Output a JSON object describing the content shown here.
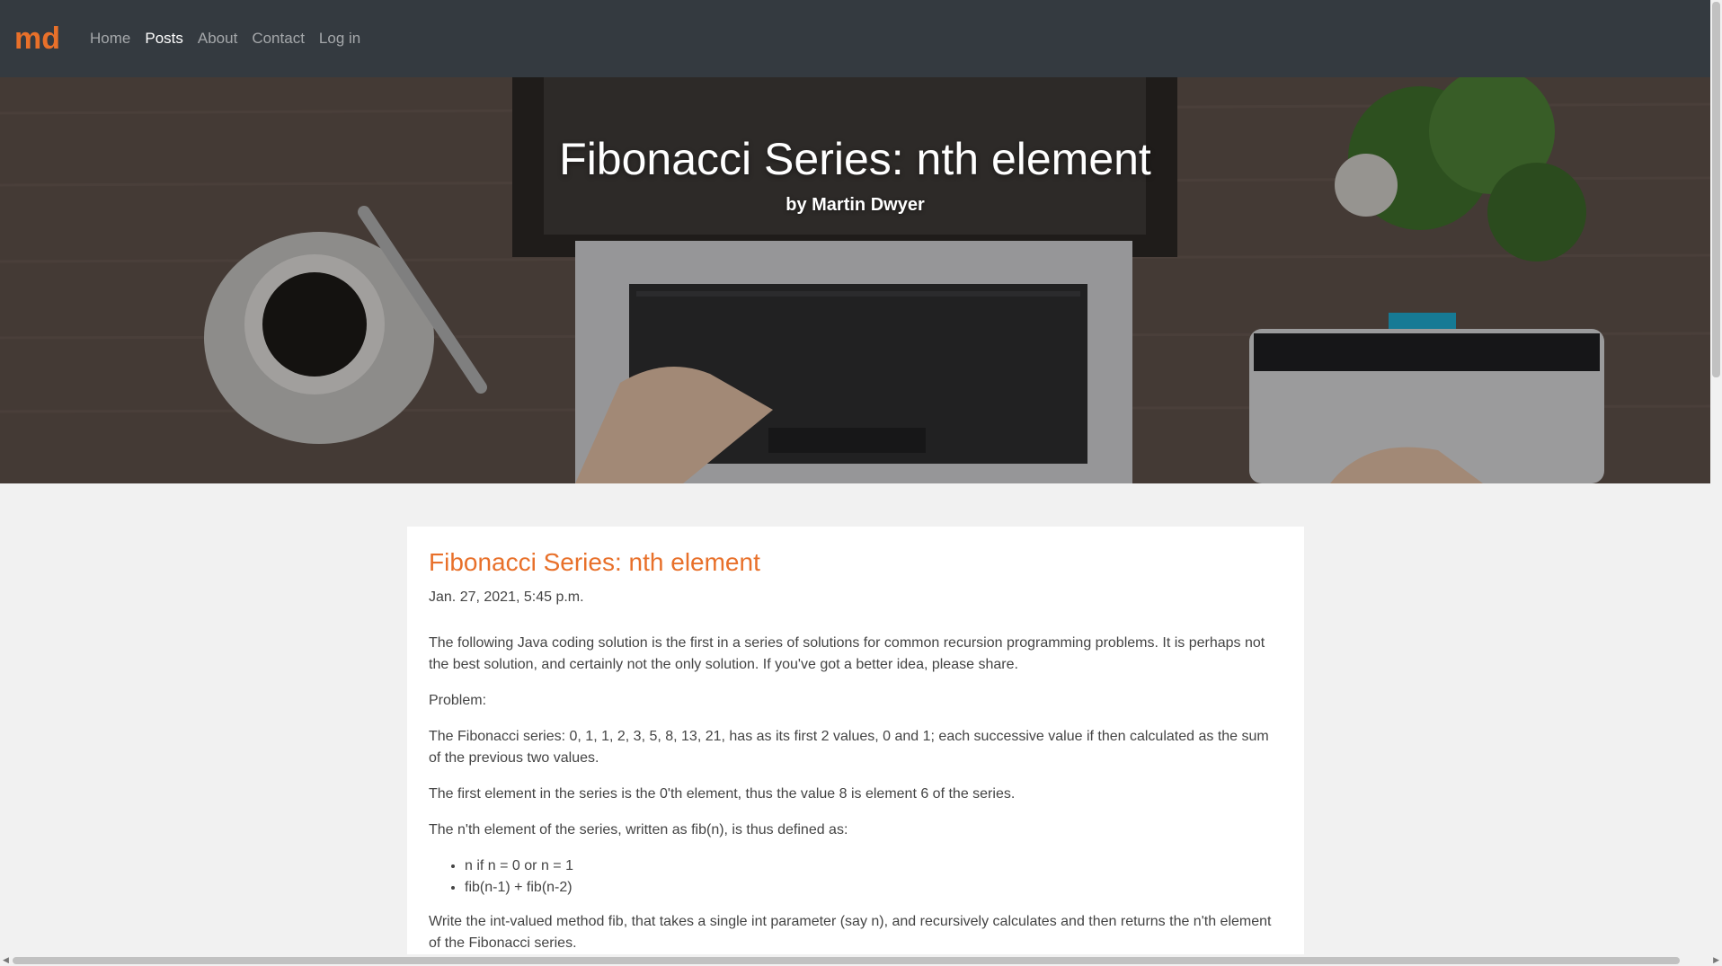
{
  "nav": {
    "brand": "md",
    "links": [
      "Home",
      "Posts",
      "About",
      "Contact",
      "Log in"
    ],
    "active": "Posts"
  },
  "hero": {
    "title": "Fibonacci Series: nth element",
    "author": "by Martin Dwyer"
  },
  "post": {
    "title": "Fibonacci Series: nth element",
    "date": "Jan. 27, 2021, 5:45 p.m.",
    "paragraphs": [
      "The following Java coding solution is the first in a series of solutions for common recursion programming problems. It is perhaps not the best solution, and certainly not the only solution. If you've got a better idea, please share.",
      "Problem:",
      "The Fibonacci series: 0, 1, 1, 2, 3, 5, 8, 13, 21, has as its first 2 values, 0 and 1; each successive value if then calculated as the sum of the previous two values.",
      "The first element in the series is the 0'th element, thus the value 8 is element 6 of the series.",
      "The n'th element of the series, written as fib(n), is thus defined as:"
    ],
    "list": [
      "n if n = 0 or n = 1",
      "fib(n-1) + fib(n-2)"
    ],
    "closing": "Write the int-valued method fib, that takes a single int parameter (say n), and recursively calculates and then returns the n'th element of the Fibonacci series."
  },
  "colors": {
    "navbar": "#343a40",
    "accent": "#e8702a",
    "page_bg": "#f1f1f1"
  }
}
